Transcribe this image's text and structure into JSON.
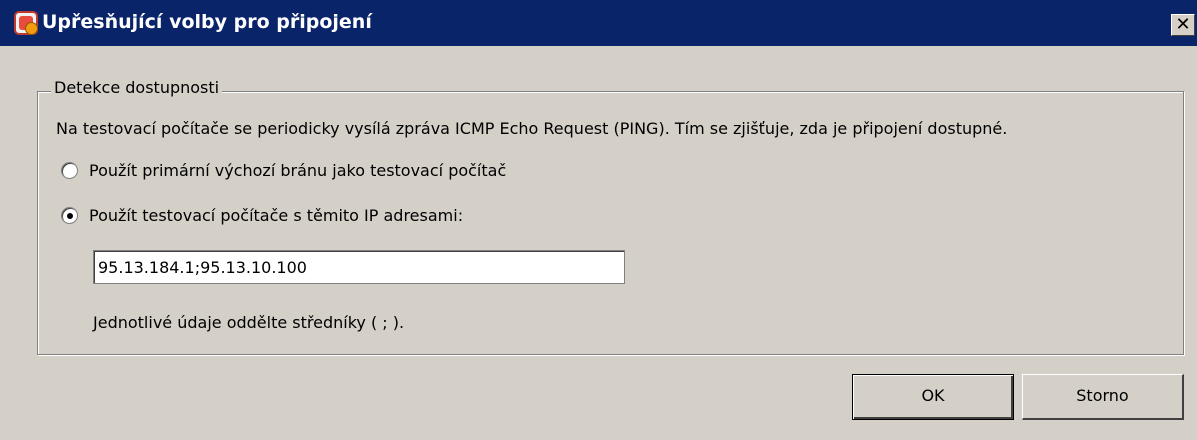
{
  "window": {
    "title": "Upřesňující volby pro připojení",
    "close_label": "✕"
  },
  "group": {
    "legend": "Detekce dostupnosti",
    "description": "Na testovací počítače se periodicky vysílá zpráva ICMP Echo Request (PING). Tím se zjišťuje, zda je připojení dostupné.",
    "options": [
      {
        "label": "Použít primární výchozí bránu jako testovací počítač",
        "selected": false
      },
      {
        "label": "Použít testovací počítače s těmito IP adresami:",
        "selected": true
      }
    ],
    "ip_value": "95.13.184.1;95.13.10.100",
    "hint": "Jednotlivé údaje oddělte středníky ( ; )."
  },
  "buttons": {
    "ok": "OK",
    "cancel": "Storno"
  },
  "icons": {
    "app": "app-settings-icon",
    "close": "close-icon"
  },
  "colors": {
    "titlebar": "#0a246a",
    "face": "#d4d0c8"
  }
}
